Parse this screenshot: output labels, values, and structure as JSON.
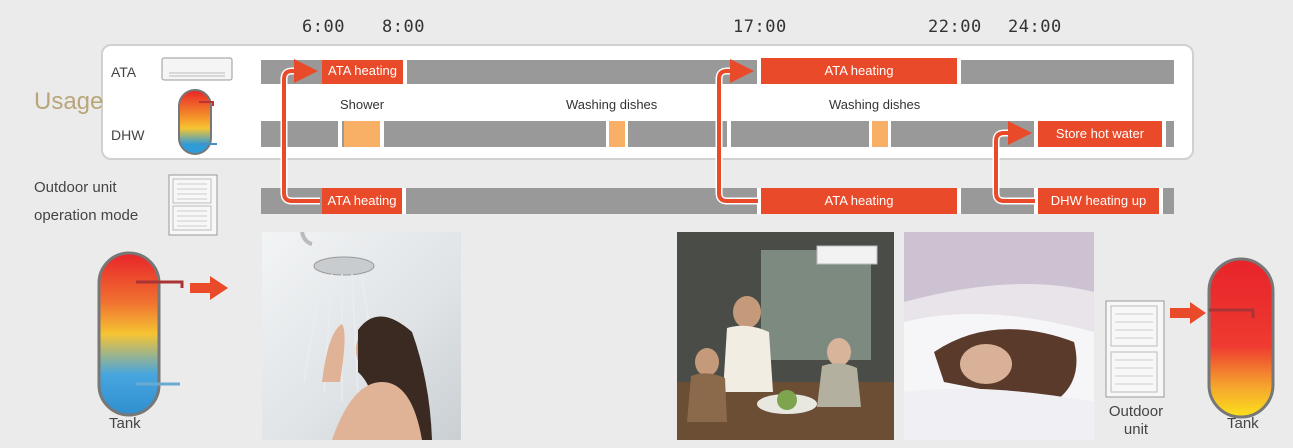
{
  "times": [
    "6:00",
    "8:00",
    "17:00",
    "22:00",
    "24:00"
  ],
  "usage_label": "Usage",
  "row_labels": {
    "ata": "ATA",
    "dhw": "DHW"
  },
  "outdoor_mode_label_1": "Outdoor unit",
  "outdoor_mode_label_2": "operation mode",
  "ata_row": {
    "seg1": "ATA heating",
    "seg2": "ATA heating"
  },
  "events": {
    "shower": "Shower",
    "dishes1": "Washing dishes",
    "dishes2": "Washing dishes"
  },
  "dhw_row": {
    "store": "Store hot water"
  },
  "outdoor_row": {
    "seg1": "ATA heating",
    "seg2": "ATA heating",
    "seg3": "DHW heating up"
  },
  "bottom": {
    "tank_left": "Tank",
    "outdoor_1": "Outdoor",
    "outdoor_2": "unit",
    "tank_right": "Tank"
  },
  "colors": {
    "red": "#e84a2a",
    "orange": "#f7b066",
    "gray_bar": "#999999",
    "bg": "#ebebeb"
  }
}
